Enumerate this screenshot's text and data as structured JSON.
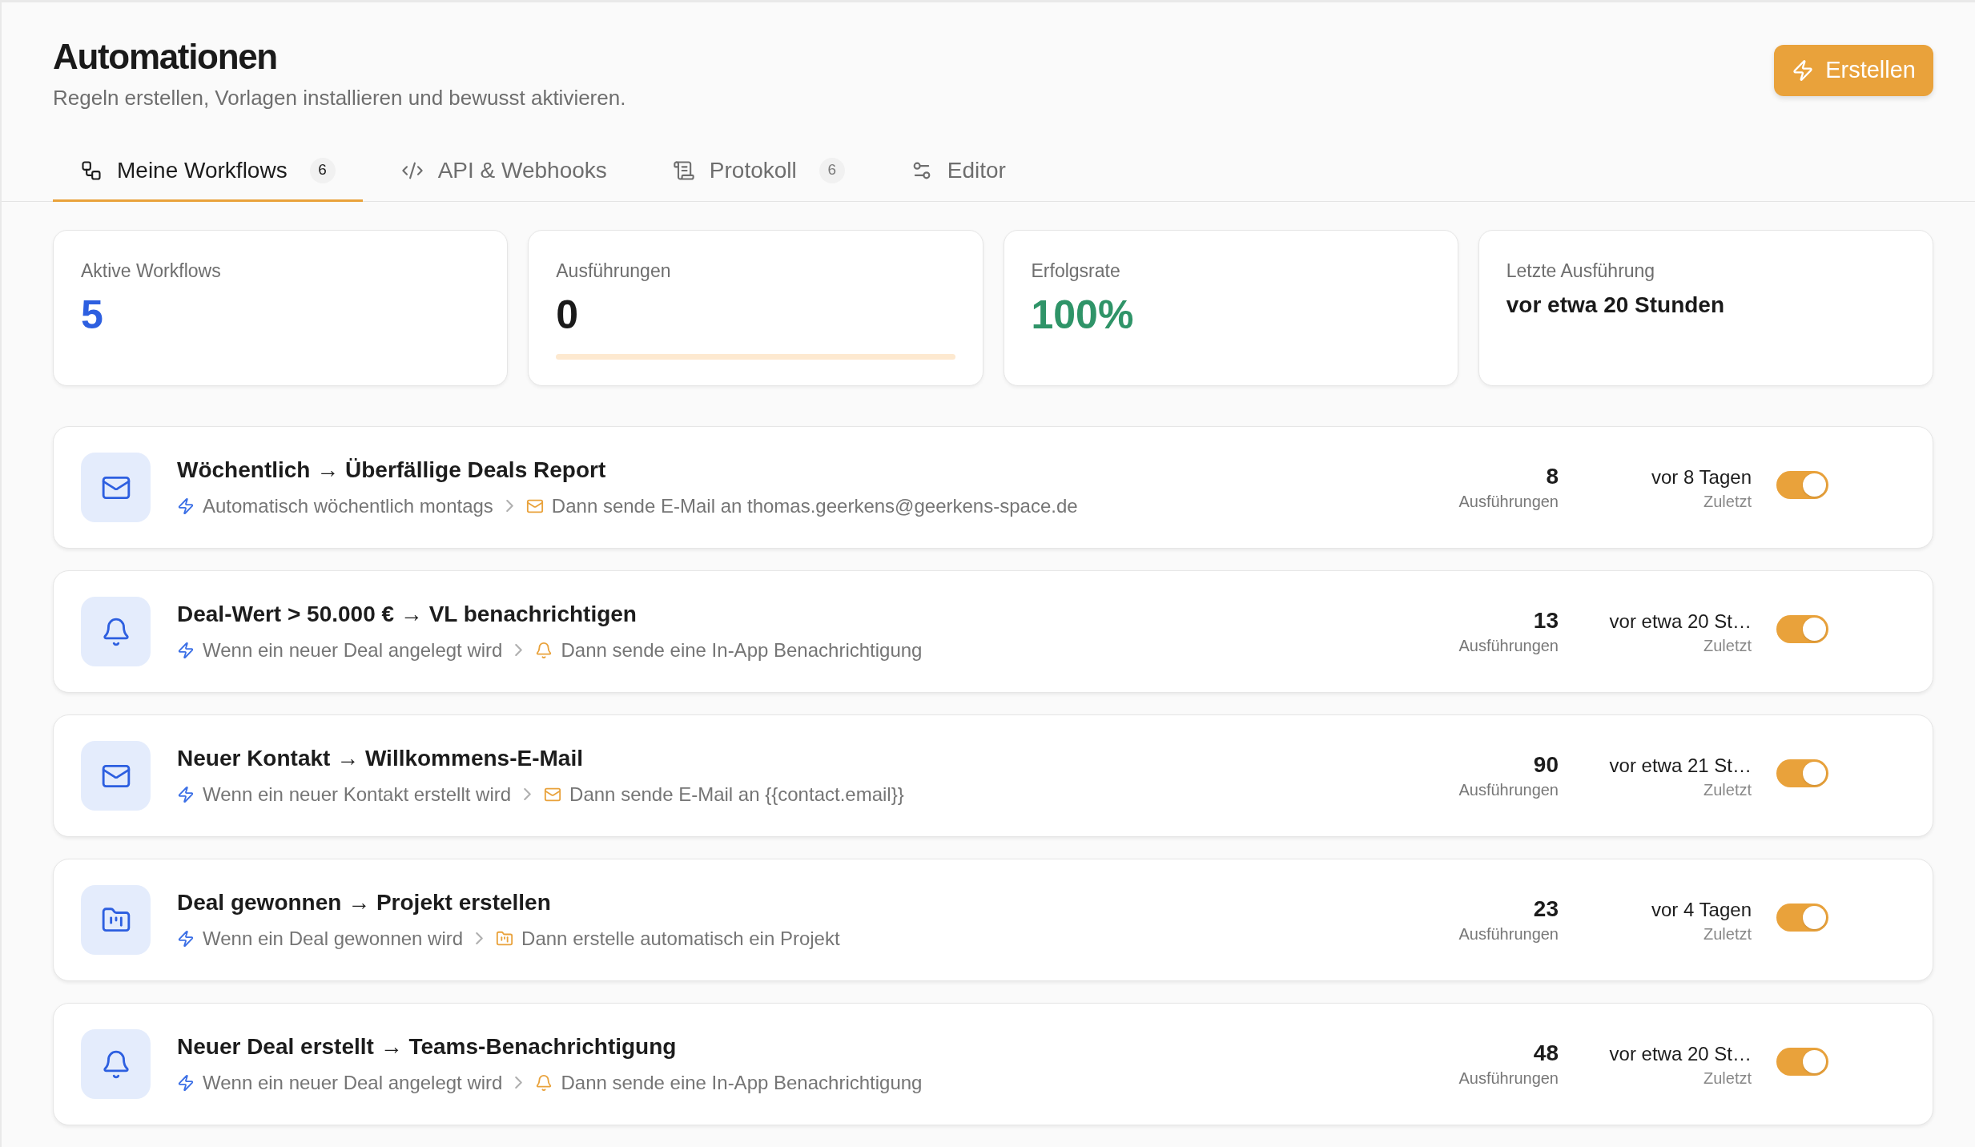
{
  "page": {
    "title": "Automationen",
    "subtitle": "Regeln erstellen, Vorlagen installieren und bewusst aktivieren."
  },
  "create_button": {
    "label": "Erstellen"
  },
  "tabs": [
    {
      "kind": "workflows",
      "label": "Meine Workflows",
      "badge": "6",
      "selected": true
    },
    {
      "kind": "api",
      "label": "API & Webhooks",
      "selected": false
    },
    {
      "kind": "log",
      "label": "Protokoll",
      "badge": "6",
      "selected": false
    },
    {
      "kind": "editor",
      "label": "Editor",
      "selected": false
    }
  ],
  "stats": [
    {
      "kind": "count",
      "label": "Aktive Workflows",
      "value": "5"
    },
    {
      "kind": "progress",
      "label": "Ausführungen",
      "value": "0",
      "level": 0
    },
    {
      "kind": "rate",
      "label": "Erfolgsrate",
      "value": "100%"
    },
    {
      "kind": "time",
      "label": "Letzte Ausführung",
      "value": "vor etwa 20 Stunden"
    }
  ],
  "workflows": [
    {
      "kind": "email",
      "title": "Wöchentlich → Überfällige Deals Report",
      "trigger": "Automatisch wöchentlich montags",
      "action": "Dann sende E-Mail an thomas.geerkens@geerkens-space.de",
      "runs": "8",
      "runs_label": "Ausführungen",
      "last_run": "vor 8 Tagen",
      "last_run_label": "Zuletzt",
      "on": true
    },
    {
      "kind": "notification",
      "title": "Deal-Wert > 50.000 € → VL benachrichtigen",
      "trigger": "Wenn ein neuer Deal angelegt wird",
      "action": "Dann sende eine In-App Benachrichtigung",
      "runs": "13",
      "runs_label": "Ausführungen",
      "last_run": "vor etwa 20 St…",
      "last_run_label": "Zuletzt",
      "on": true
    },
    {
      "kind": "email",
      "title": "Neuer Kontakt → Willkommens-E-Mail",
      "trigger": "Wenn ein neuer Kontakt erstellt wird",
      "action": "Dann sende E-Mail an {{contact.email}}",
      "runs": "90",
      "runs_label": "Ausführungen",
      "last_run": "vor etwa 21 St…",
      "last_run_label": "Zuletzt",
      "on": true
    },
    {
      "kind": "project",
      "title": "Deal gewonnen → Projekt erstellen",
      "trigger": "Wenn ein Deal gewonnen wird",
      "action": "Dann erstelle automatisch ein Projekt",
      "runs": "23",
      "runs_label": "Ausführungen",
      "last_run": "vor 4 Tagen",
      "last_run_label": "Zuletzt",
      "on": true
    },
    {
      "kind": "notification",
      "title": "Neuer Deal erstellt → Teams-Benachrichtigung",
      "trigger": "Wenn ein neuer Deal angelegt wird",
      "action": "Dann sende eine In-App Benachrichtigung",
      "runs": "48",
      "runs_label": "Ausführungen",
      "last_run": "vor etwa 20 St…",
      "last_run_label": "Zuletzt",
      "on": true
    }
  ]
}
